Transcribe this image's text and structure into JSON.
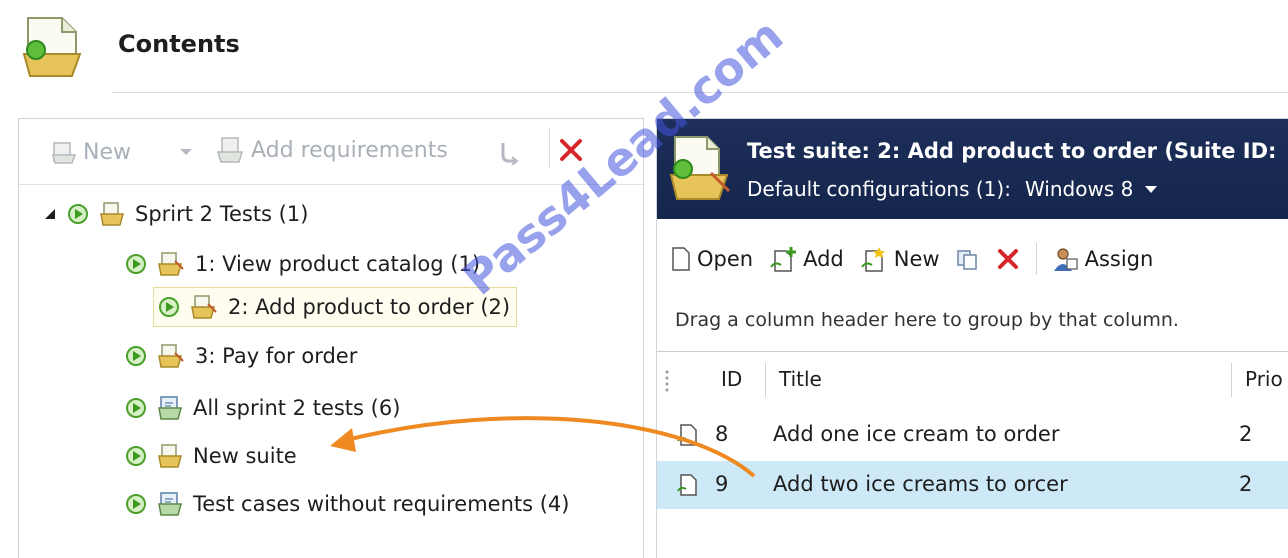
{
  "header": {
    "title": "Contents"
  },
  "left_toolbar": {
    "new_label": "New",
    "add_requirements_label": "Add requirements"
  },
  "tree": {
    "root": {
      "label": "Sprirt 2 Tests (1)"
    },
    "children": [
      {
        "label": "1: View product catalog (1)"
      },
      {
        "label": "2: Add product to order (2)"
      },
      {
        "label": "3: Pay for order"
      },
      {
        "label": "All sprint 2 tests (6)"
      },
      {
        "label": "New suite"
      },
      {
        "label": "Test cases without requirements (4)"
      }
    ]
  },
  "suite": {
    "title": "Test suite:  2: Add product to order (Suite ID:",
    "config_label": "Default configurations (1):",
    "config_value": "Windows 8"
  },
  "right_toolbar": {
    "open_label": "Open",
    "add_label": "Add",
    "new_label": "New",
    "assign_label": "Assign"
  },
  "grid": {
    "group_hint": "Drag a column header here to group by that column.",
    "columns": {
      "id": "ID",
      "title": "Title",
      "priority": "Prio"
    },
    "rows": [
      {
        "id": "8",
        "title": "Add one ice cream to order",
        "priority": "2"
      },
      {
        "id": "9",
        "title": "Add two ice creams to orcer",
        "priority": "2"
      }
    ]
  },
  "watermark": "Pass4Lead.com",
  "colors": {
    "header_bar": "#1d2f5a",
    "selected_row": "#cde8f6",
    "arrow": "#ef8a22",
    "delete_red": "#d6262a",
    "watermark": "#4454dc"
  }
}
